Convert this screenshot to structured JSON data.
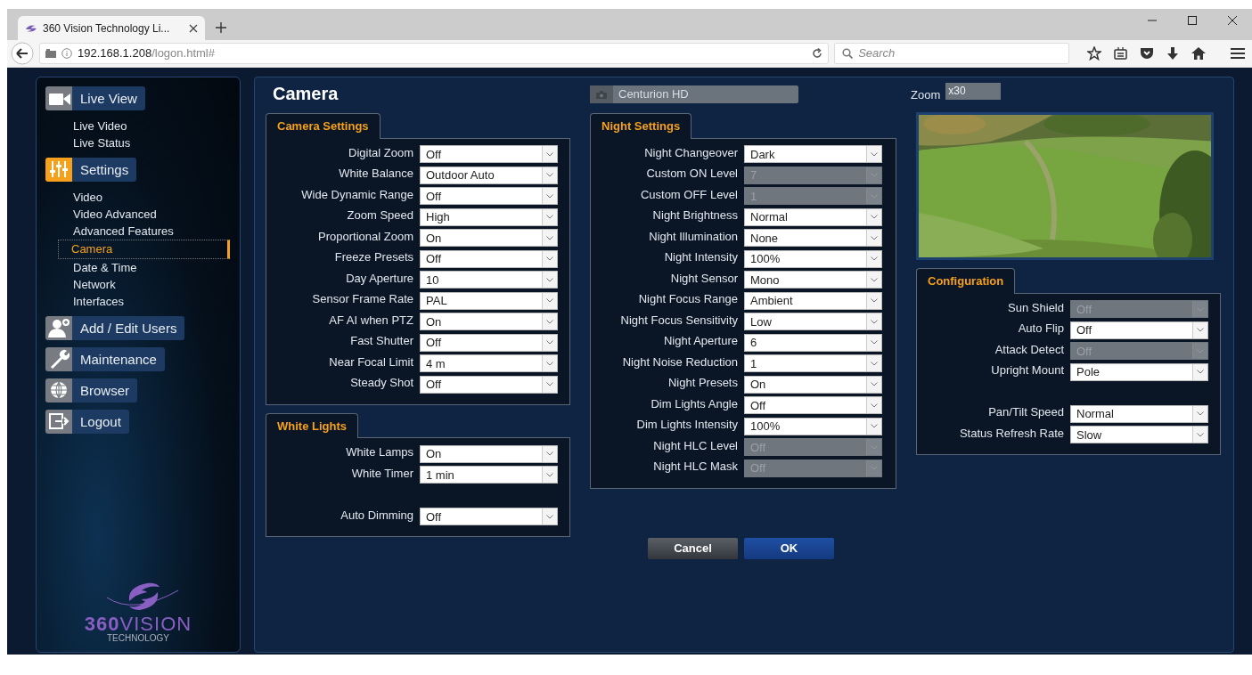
{
  "browser": {
    "tab_title": "360 Vision Technology Li...",
    "url_host": "192.168.1.208",
    "url_path": "/logon.html#",
    "search_placeholder": "Search"
  },
  "sidebar": [
    {
      "label": "Live View",
      "active": false,
      "items": [
        {
          "label": "Live Video",
          "selected": false
        },
        {
          "label": "Live Status",
          "selected": false
        }
      ]
    },
    {
      "label": "Settings",
      "active": true,
      "items": [
        {
          "label": "Video",
          "selected": false
        },
        {
          "label": "Video Advanced",
          "selected": false
        },
        {
          "label": "Advanced Features",
          "selected": false
        },
        {
          "label": "Camera",
          "selected": true
        },
        {
          "label": "Date & Time",
          "selected": false
        },
        {
          "label": "Network",
          "selected": false
        },
        {
          "label": "Interfaces",
          "selected": false
        }
      ]
    },
    {
      "label": "Add / Edit Users",
      "active": false
    },
    {
      "label": "Maintenance",
      "active": false
    },
    {
      "label": "Browser",
      "active": false
    },
    {
      "label": "Logout",
      "active": false
    }
  ],
  "logo": {
    "brand_bold": "360",
    "brand_light": "VISION",
    "tagline": "TECHNOLOGY"
  },
  "page_title": "Camera",
  "camera_name": "Centurion HD",
  "zoom": {
    "label": "Zoom",
    "value": "x30"
  },
  "panels": [
    {
      "title": "Camera Settings",
      "rows": [
        {
          "kind": "select",
          "label": "Digital Zoom",
          "value": "Off",
          "disabled": false
        },
        {
          "kind": "select",
          "label": "White Balance",
          "value": "Outdoor Auto",
          "disabled": false
        },
        {
          "kind": "select",
          "label": "Wide Dynamic Range",
          "value": "Off",
          "disabled": false
        },
        {
          "kind": "select",
          "label": "Zoom Speed",
          "value": "High",
          "disabled": false
        },
        {
          "kind": "select",
          "label": "Proportional Zoom",
          "value": "On",
          "disabled": false
        },
        {
          "kind": "select",
          "label": "Freeze Presets",
          "value": "Off",
          "disabled": false
        },
        {
          "kind": "select",
          "label": "Day Aperture",
          "value": "10",
          "disabled": false
        },
        {
          "kind": "select",
          "label": "Sensor Frame Rate",
          "value": "PAL",
          "disabled": false
        },
        {
          "kind": "select",
          "label": "AF AI when PTZ",
          "value": "On",
          "disabled": false
        },
        {
          "kind": "select",
          "label": "Fast Shutter",
          "value": "Off",
          "disabled": false
        },
        {
          "kind": "select",
          "label": "Near Focal Limit",
          "value": "4 m",
          "disabled": false
        },
        {
          "kind": "select",
          "label": "Steady Shot",
          "value": "Off",
          "disabled": false
        }
      ]
    },
    {
      "title": "White Lights",
      "rows": [
        {
          "kind": "select",
          "label": "White Lamps",
          "value": "On",
          "disabled": false
        },
        {
          "kind": "select",
          "label": "White Timer",
          "value": "1 min",
          "disabled": false
        },
        {
          "kind": "spacer"
        },
        {
          "kind": "select",
          "label": "Auto Dimming",
          "value": "Off",
          "disabled": false
        }
      ]
    },
    {
      "title": "Night Settings",
      "rows": [
        {
          "kind": "select",
          "label": "Night Changeover",
          "value": "Dark",
          "disabled": false
        },
        {
          "kind": "select",
          "label": "Custom ON Level",
          "value": "7",
          "disabled": true
        },
        {
          "kind": "select",
          "label": "Custom OFF Level",
          "value": "1",
          "disabled": true
        },
        {
          "kind": "select",
          "label": "Night Brightness",
          "value": "Normal",
          "disabled": false
        },
        {
          "kind": "select",
          "label": "Night Illumination",
          "value": "None",
          "disabled": false
        },
        {
          "kind": "select",
          "label": "Night Intensity",
          "value": "100%",
          "disabled": false
        },
        {
          "kind": "select",
          "label": "Night Sensor",
          "value": "Mono",
          "disabled": false
        },
        {
          "kind": "select",
          "label": "Night Focus Range",
          "value": "Ambient",
          "disabled": false
        },
        {
          "kind": "select",
          "label": "Night Focus Sensitivity",
          "value": "Low",
          "disabled": false
        },
        {
          "kind": "select",
          "label": "Night Aperture",
          "value": "6",
          "disabled": false
        },
        {
          "kind": "select",
          "label": "Night Noise Reduction",
          "value": "1",
          "disabled": false
        },
        {
          "kind": "select",
          "label": "Night Presets",
          "value": "On",
          "disabled": false
        },
        {
          "kind": "select",
          "label": "Dim Lights Angle",
          "value": "Off",
          "disabled": false
        },
        {
          "kind": "select",
          "label": "Dim Lights Intensity",
          "value": "100%",
          "disabled": false
        },
        {
          "kind": "select",
          "label": "Night HLC Level",
          "value": "Off",
          "disabled": true
        },
        {
          "kind": "select",
          "label": "Night HLC Mask",
          "value": "Off",
          "disabled": true
        }
      ]
    },
    {
      "title": "Configuration",
      "rows": [
        {
          "kind": "select",
          "label": "Sun Shield",
          "value": "Off",
          "disabled": true
        },
        {
          "kind": "select",
          "label": "Auto Flip",
          "value": "Off",
          "disabled": false
        },
        {
          "kind": "select",
          "label": "Attack Detect",
          "value": "Off",
          "disabled": true
        },
        {
          "kind": "select",
          "label": "Upright Mount",
          "value": "Pole",
          "disabled": false
        },
        {
          "kind": "spacer"
        },
        {
          "kind": "select",
          "label": "Pan/Tilt Speed",
          "value": "Normal",
          "disabled": false
        },
        {
          "kind": "select",
          "label": "Status Refresh Rate",
          "value": "Slow",
          "disabled": false
        }
      ]
    }
  ],
  "buttons": [
    {
      "label": "Cancel",
      "kind": "secondary"
    },
    {
      "label": "OK",
      "kind": "primary"
    }
  ]
}
